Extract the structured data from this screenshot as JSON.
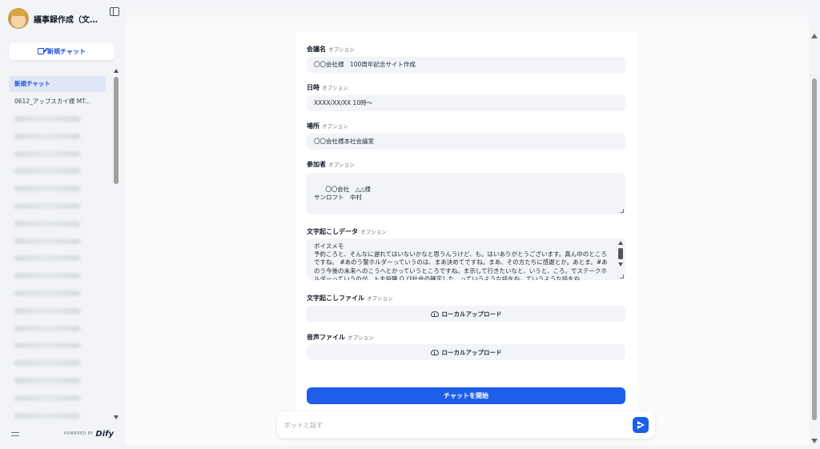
{
  "app": {
    "title": "議事録作成（文..."
  },
  "sidebar": {
    "new_chat_label": "新規チャット",
    "conversations": [
      {
        "label": "新規チャット",
        "active": true,
        "blurred": false
      },
      {
        "label": "0612_アップスカイ様 MT...",
        "active": false,
        "blurred": false
      },
      {
        "label": "",
        "blurred": true
      },
      {
        "label": "",
        "blurred": true
      },
      {
        "label": "",
        "blurred": true
      },
      {
        "label": "",
        "blurred": true
      },
      {
        "label": "",
        "blurred": true
      },
      {
        "label": "",
        "blurred": true
      },
      {
        "label": "",
        "blurred": true
      },
      {
        "label": "",
        "blurred": true
      },
      {
        "label": "",
        "blurred": true
      },
      {
        "label": "",
        "blurred": true
      },
      {
        "label": "",
        "blurred": true
      },
      {
        "label": "",
        "blurred": true
      },
      {
        "label": "",
        "blurred": true
      },
      {
        "label": "",
        "blurred": true
      },
      {
        "label": "",
        "blurred": true
      },
      {
        "label": "",
        "blurred": true
      },
      {
        "label": "",
        "blurred": true
      },
      {
        "label": "",
        "blurred": true
      }
    ],
    "powered_by": "POWERED BY",
    "brand": "Dify"
  },
  "form": {
    "optional_label": "オプション",
    "meeting_name": {
      "label": "会議名",
      "value": "〇〇会社様　100周年記念サイト作成"
    },
    "datetime": {
      "label": "日時",
      "value": "XXXX/XX/XX 10時～"
    },
    "place": {
      "label": "場所",
      "value": "〇〇会社様本社会議室"
    },
    "participants": {
      "label": "参加者",
      "value": "〇〇会社　△△様\nサンロフト　中村"
    },
    "transcript": {
      "label": "文字起こしデータ",
      "value": "ボイスメモ\n予約ころと、そんなに遅れてはいないかなと思うんうけど、も。はいありがとうございます。真ん中のところですね。 #あのう警ホルダーっていうのは、まあ決めてですね。まあ、その方たちに感謝とか。あとま。#あのう今後の未来へのこうへとかっていうところですね。ま示して行きたいなと、いうと、ころ。でステークホルダーっていうのが、ト主役職 O び社会の確定した、っていうような話をね。ていうような話をね"
    },
    "transcript_file": {
      "label": "文字起こしファイル",
      "upload_label": "ローカルアップロード"
    },
    "audio_file": {
      "label": "音声ファイル",
      "upload_label": "ローカルアップロード"
    },
    "start_label": "チャットを開始"
  },
  "chat": {
    "placeholder": "ボットと話す"
  },
  "colors": {
    "accent": "#1d5fe8",
    "active_item_bg": "#dfe7f7",
    "field_bg": "#f2f4f7"
  }
}
